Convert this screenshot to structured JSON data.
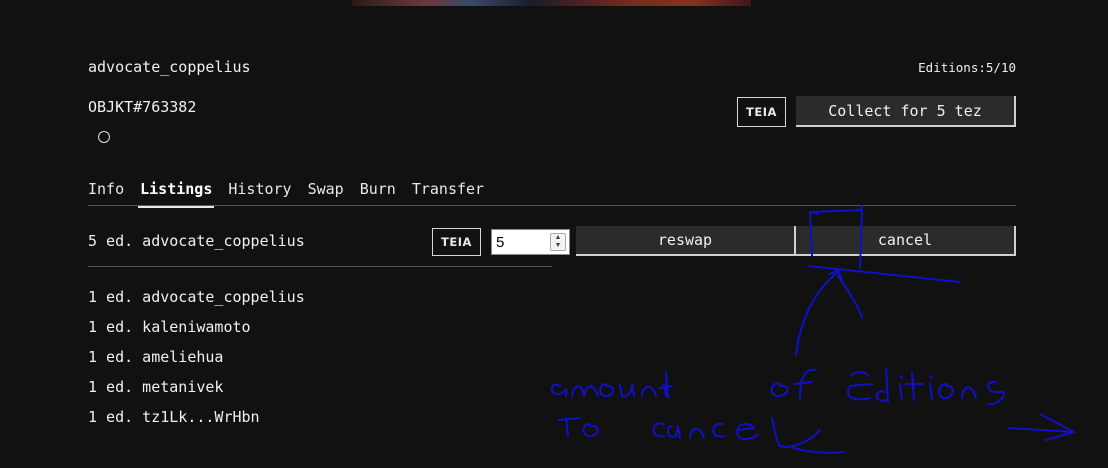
{
  "header": {
    "creator": "advocate_coppelius",
    "editions": "Editions:5/10",
    "objkt_id": "OBJKT#763382"
  },
  "purchase": {
    "market_badge": "TEIA",
    "collect_label": "Collect for 5 tez"
  },
  "tabs": [
    {
      "label": "Info",
      "active": false
    },
    {
      "label": "Listings",
      "active": true
    },
    {
      "label": "History",
      "active": false
    },
    {
      "label": "Swap",
      "active": false
    },
    {
      "label": "Burn",
      "active": false
    },
    {
      "label": "Transfer",
      "active": false
    }
  ],
  "listing": {
    "text": "5 ed. advocate_coppelius",
    "market_badge": "TEIA",
    "quantity_value": "5",
    "reswap_label": "reswap",
    "cancel_label": "cancel"
  },
  "holders": [
    "1 ed. advocate_coppelius",
    "1 ed. kaleniwamoto",
    "1 ed. ameliehua",
    "1 ed. metanivek",
    "1 ed. tz1Lk...WrHbn"
  ],
  "annotation": {
    "color": "#1010c8",
    "note": "amount of editions to cancel"
  },
  "colors": {
    "background": "#111111",
    "button": "#2b2b2b",
    "text": "#f0f0f0"
  }
}
